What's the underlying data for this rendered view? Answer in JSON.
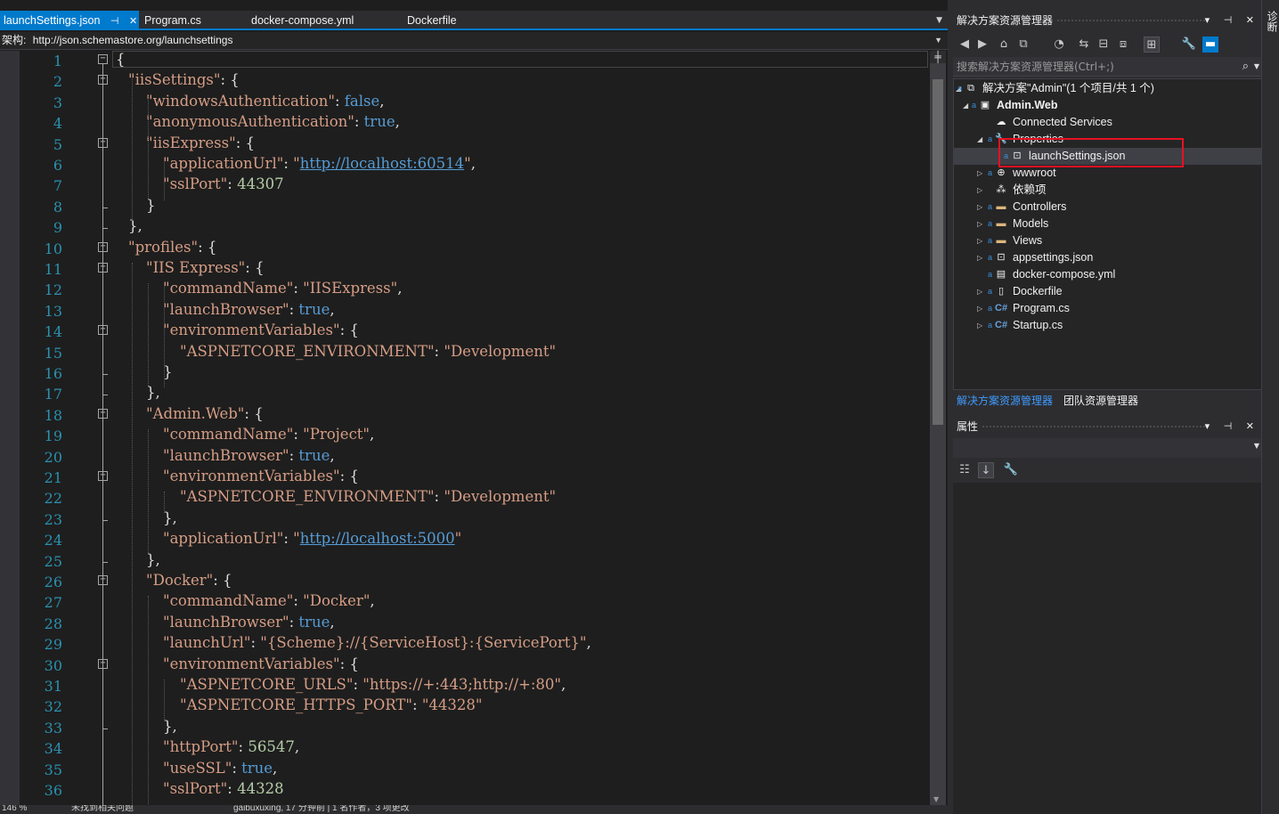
{
  "tabs": [
    {
      "label": "launchSettings.json",
      "active": true,
      "pin": "⊣",
      "close": "✕"
    },
    {
      "label": "Program.cs",
      "active": false
    },
    {
      "label": "docker-compose.yml",
      "active": false
    },
    {
      "label": "Dockerfile",
      "active": false
    }
  ],
  "navbar": {
    "schema_label": "架构:",
    "schema_url": "http://json.schemastore.org/launchsettings"
  },
  "line_numbers": [
    "1",
    "2",
    "3",
    "4",
    "5",
    "6",
    "7",
    "8",
    "9",
    "10",
    "11",
    "12",
    "13",
    "14",
    "15",
    "16",
    "17",
    "18",
    "19",
    "20",
    "21",
    "22",
    "23",
    "24",
    "25",
    "26",
    "27",
    "28",
    "29",
    "30",
    "31",
    "32",
    "33",
    "34",
    "35",
    "36"
  ],
  "code": [
    [
      {
        "t": "{",
        "c": ""
      }
    ],
    [
      {
        "t": "\"iisSettings\"",
        "c": "k"
      },
      {
        "t": ": {",
        "c": ""
      }
    ],
    [
      {
        "t": "\"windowsAuthentication\"",
        "c": "k"
      },
      {
        "t": ": ",
        "c": ""
      },
      {
        "t": "false",
        "c": "bool"
      },
      {
        "t": ",",
        "c": ""
      }
    ],
    [
      {
        "t": "\"anonymousAuthentication\"",
        "c": "k"
      },
      {
        "t": ": ",
        "c": ""
      },
      {
        "t": "true",
        "c": "bool"
      },
      {
        "t": ",",
        "c": ""
      }
    ],
    [
      {
        "t": "\"iisExpress\"",
        "c": "k"
      },
      {
        "t": ": {",
        "c": ""
      }
    ],
    [
      {
        "t": "\"applicationUrl\"",
        "c": "k"
      },
      {
        "t": ": ",
        "c": ""
      },
      {
        "t": "\"",
        "c": "kv"
      },
      {
        "t": "http://localhost:60514",
        "c": "url"
      },
      {
        "t": "\"",
        "c": "kv"
      },
      {
        "t": ",",
        "c": ""
      }
    ],
    [
      {
        "t": "\"sslPort\"",
        "c": "k"
      },
      {
        "t": ": ",
        "c": ""
      },
      {
        "t": "44307",
        "c": "num"
      }
    ],
    [
      {
        "t": "}",
        "c": ""
      }
    ],
    [
      {
        "t": "},",
        "c": ""
      }
    ],
    [
      {
        "t": "\"profiles\"",
        "c": "k"
      },
      {
        "t": ": {",
        "c": ""
      }
    ],
    [
      {
        "t": "\"IIS Express\"",
        "c": "k"
      },
      {
        "t": ": {",
        "c": ""
      }
    ],
    [
      {
        "t": "\"commandName\"",
        "c": "k"
      },
      {
        "t": ": ",
        "c": ""
      },
      {
        "t": "\"IISExpress\"",
        "c": "kv"
      },
      {
        "t": ",",
        "c": ""
      }
    ],
    [
      {
        "t": "\"launchBrowser\"",
        "c": "k"
      },
      {
        "t": ": ",
        "c": ""
      },
      {
        "t": "true",
        "c": "bool"
      },
      {
        "t": ",",
        "c": ""
      }
    ],
    [
      {
        "t": "\"environmentVariables\"",
        "c": "k"
      },
      {
        "t": ": {",
        "c": ""
      }
    ],
    [
      {
        "t": "\"ASPNETCORE_ENVIRONMENT\"",
        "c": "k"
      },
      {
        "t": ": ",
        "c": ""
      },
      {
        "t": "\"Development\"",
        "c": "kv"
      }
    ],
    [
      {
        "t": "}",
        "c": ""
      }
    ],
    [
      {
        "t": "},",
        "c": ""
      }
    ],
    [
      {
        "t": "\"Admin.Web\"",
        "c": "k"
      },
      {
        "t": ": {",
        "c": ""
      }
    ],
    [
      {
        "t": "\"commandName\"",
        "c": "k"
      },
      {
        "t": ": ",
        "c": ""
      },
      {
        "t": "\"Project\"",
        "c": "kv"
      },
      {
        "t": ",",
        "c": ""
      }
    ],
    [
      {
        "t": "\"launchBrowser\"",
        "c": "k"
      },
      {
        "t": ": ",
        "c": ""
      },
      {
        "t": "true",
        "c": "bool"
      },
      {
        "t": ",",
        "c": ""
      }
    ],
    [
      {
        "t": "\"environmentVariables\"",
        "c": "k"
      },
      {
        "t": ": {",
        "c": ""
      }
    ],
    [
      {
        "t": "\"ASPNETCORE_ENVIRONMENT\"",
        "c": "k"
      },
      {
        "t": ": ",
        "c": ""
      },
      {
        "t": "\"Development\"",
        "c": "kv"
      }
    ],
    [
      {
        "t": "},",
        "c": ""
      }
    ],
    [
      {
        "t": "\"applicationUrl\"",
        "c": "k"
      },
      {
        "t": ": ",
        "c": ""
      },
      {
        "t": "\"",
        "c": "kv"
      },
      {
        "t": "http://localhost:5000",
        "c": "url"
      },
      {
        "t": "\"",
        "c": "kv"
      }
    ],
    [
      {
        "t": "},",
        "c": ""
      }
    ],
    [
      {
        "t": "\"Docker\"",
        "c": "k"
      },
      {
        "t": ": {",
        "c": ""
      }
    ],
    [
      {
        "t": "\"commandName\"",
        "c": "k"
      },
      {
        "t": ": ",
        "c": ""
      },
      {
        "t": "\"Docker\"",
        "c": "kv"
      },
      {
        "t": ",",
        "c": ""
      }
    ],
    [
      {
        "t": "\"launchBrowser\"",
        "c": "k"
      },
      {
        "t": ": ",
        "c": ""
      },
      {
        "t": "true",
        "c": "bool"
      },
      {
        "t": ",",
        "c": ""
      }
    ],
    [
      {
        "t": "\"launchUrl\"",
        "c": "k"
      },
      {
        "t": ": ",
        "c": ""
      },
      {
        "t": "\"{Scheme}://{ServiceHost}:{ServicePort}\"",
        "c": "kv"
      },
      {
        "t": ",",
        "c": ""
      }
    ],
    [
      {
        "t": "\"environmentVariables\"",
        "c": "k"
      },
      {
        "t": ": {",
        "c": ""
      }
    ],
    [
      {
        "t": "\"ASPNETCORE_URLS\"",
        "c": "k"
      },
      {
        "t": ": ",
        "c": ""
      },
      {
        "t": "\"https://+:443;http://+:80\"",
        "c": "kv"
      },
      {
        "t": ",",
        "c": ""
      }
    ],
    [
      {
        "t": "\"ASPNETCORE_HTTPS_PORT\"",
        "c": "k"
      },
      {
        "t": ": ",
        "c": ""
      },
      {
        "t": "\"44328\"",
        "c": "kv"
      }
    ],
    [
      {
        "t": "},",
        "c": ""
      }
    ],
    [
      {
        "t": "\"httpPort\"",
        "c": "k"
      },
      {
        "t": ": ",
        "c": ""
      },
      {
        "t": "56547",
        "c": "num"
      },
      {
        "t": ",",
        "c": ""
      }
    ],
    [
      {
        "t": "\"useSSL\"",
        "c": "k"
      },
      {
        "t": ": ",
        "c": ""
      },
      {
        "t": "true",
        "c": "bool"
      },
      {
        "t": ",",
        "c": ""
      }
    ],
    [
      {
        "t": "\"sslPort\"",
        "c": "k"
      },
      {
        "t": ": ",
        "c": ""
      },
      {
        "t": "44328",
        "c": "num"
      }
    ]
  ],
  "statusbar": {
    "zoom": "146 %",
    "issues": "未找到相关问题",
    "git": "gaibuxuxing, 17 分钟前 | 1 名作者，3 项更改"
  },
  "solution_explorer": {
    "title": "解决方案资源管理器",
    "controls": "▾ ⊣ ✕",
    "search_placeholder": "搜索解决方案资源管理器(Ctrl+;)",
    "solution_label": "解决方案\"Admin\"(1 个项目/共 1 个)",
    "tree": [
      {
        "label": "Admin.Web",
        "icon": "project-icon",
        "glyph": "▣",
        "bold": true
      },
      {
        "label": "Connected Services",
        "icon": "connected-services-icon",
        "glyph": "☁"
      },
      {
        "label": "Properties",
        "icon": "wrench-icon",
        "glyph": "🔧"
      },
      {
        "label": "launchSettings.json",
        "icon": "json-file-icon",
        "glyph": "⊡",
        "selected": true
      },
      {
        "label": "wwwroot",
        "icon": "globe-icon",
        "glyph": "⊕"
      },
      {
        "label": "依赖项",
        "icon": "dependencies-icon",
        "glyph": "⁂"
      },
      {
        "label": "Controllers",
        "icon": "folder-icon",
        "glyph": "▬"
      },
      {
        "label": "Models",
        "icon": "folder-icon",
        "glyph": "▬"
      },
      {
        "label": "Views",
        "icon": "folder-icon",
        "glyph": "▬"
      },
      {
        "label": "appsettings.json",
        "icon": "json-file-icon",
        "glyph": "⊡"
      },
      {
        "label": "docker-compose.yml",
        "icon": "yml-file-icon",
        "glyph": "▤"
      },
      {
        "label": "Dockerfile",
        "icon": "file-icon",
        "glyph": "▯"
      },
      {
        "label": "Program.cs",
        "icon": "csharp-file-icon",
        "glyph": "C#"
      },
      {
        "label": "Startup.cs",
        "icon": "csharp-file-icon",
        "glyph": "C#"
      }
    ],
    "bottom_tabs": [
      "解决方案资源管理器",
      "团队资源管理器"
    ]
  },
  "properties": {
    "title": "属性",
    "controls": "▾ ⊣ ✕"
  },
  "side_strip": {
    "label": "诊断"
  },
  "colors": {
    "accent": "#007acc",
    "highlight_box": "#e81123",
    "code_key": "#d69d85",
    "code_bool": "#569cd6",
    "code_number": "#b5cea8",
    "line_number": "#2b91af"
  }
}
